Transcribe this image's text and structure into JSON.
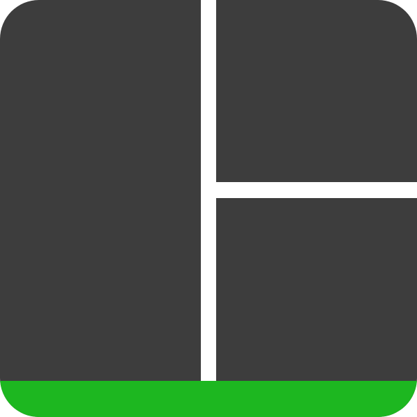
{
  "icon": {
    "name": "split-layout-icon",
    "colors": {
      "panel": "#3d3d3d",
      "divider": "#ffffff",
      "accent_bar": "#1db720"
    }
  }
}
